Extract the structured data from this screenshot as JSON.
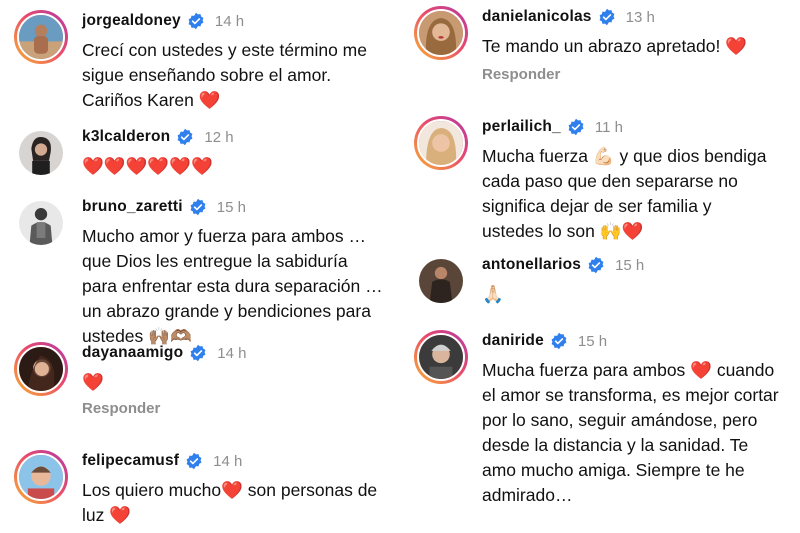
{
  "colors": {
    "username": "#111111",
    "time": "#8e8e8e",
    "verified": "#2f80ed",
    "heart": "#e0202e"
  },
  "left_comments": [
    {
      "username": "jorgealdoney",
      "time": "14 h",
      "text": "Crecí con ustedes y este término me\nsigue enseñando sobre el amor.\nCariños Karen ❤️",
      "avatar_icon": "avatar-photo-icon"
    },
    {
      "username": "k3lcalderon",
      "time": "12 h",
      "text": "❤️❤️❤️❤️❤️❤️",
      "avatar_icon": "avatar-photo-icon"
    },
    {
      "username": "bruno_zaretti",
      "time": "15 h",
      "text": "Mucho amor y fuerza para ambos …\nque Dios les entregue la sabiduría\npara enfrentar esta dura separación …\nun abrazo grande y bendiciones para\nustedes 🙌🏽🫶🏽",
      "avatar_icon": "avatar-photo-icon"
    },
    {
      "username": "dayanaamigo",
      "time": "14 h",
      "text": "❤️",
      "reply": "Responder",
      "avatar_icon": "avatar-photo-icon"
    },
    {
      "username": "felipecamusf",
      "time": "14 h",
      "text": "Los quiero mucho❤️ son personas de\nluz ❤️",
      "avatar_icon": "avatar-photo-icon"
    }
  ],
  "right_comments": [
    {
      "username": "danielanicolas",
      "time": "13 h",
      "text": "Te mando un abrazo apretado! ❤️",
      "reply": "Responder",
      "avatar_icon": "avatar-photo-icon"
    },
    {
      "username": "perlailich_",
      "time": "11 h",
      "text": "Mucha fuerza 💪🏻 y que dios bendiga\ncada paso que den separarse no\nsignifica dejar de ser familia  y\nustedes lo son 🙌❤️",
      "avatar_icon": "avatar-photo-icon"
    },
    {
      "username": "antonellarios",
      "time": "15 h",
      "text": "🙏🏻",
      "avatar_icon": "avatar-photo-icon"
    },
    {
      "username": "daniride",
      "time": "15 h",
      "text": "Mucha fuerza para ambos ❤️ cuando\nel amor se transforma, es mejor cortar\npor lo sano, seguir amándose, pero\ndesde la distancia y la sanidad. Te\namo mucho amiga. Siempre te he\nadmirado…",
      "avatar_icon": "avatar-photo-icon"
    }
  ]
}
